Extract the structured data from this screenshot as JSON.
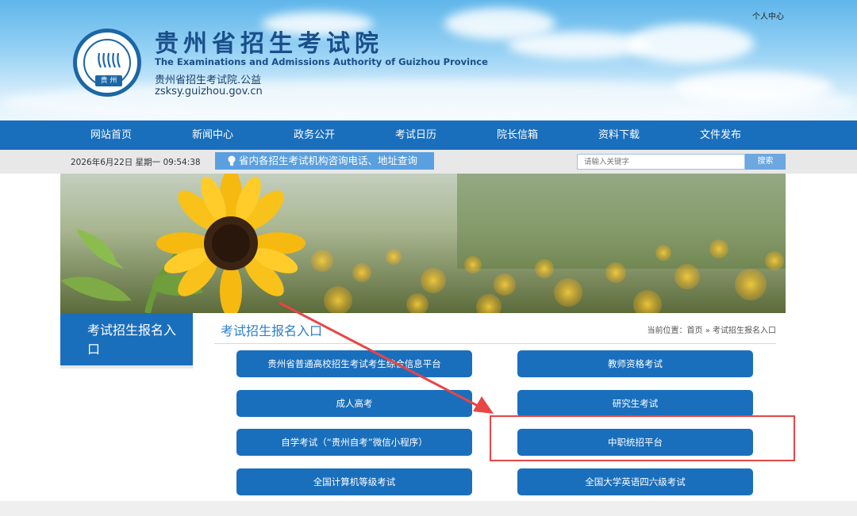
{
  "header": {
    "user_center": "个人中心",
    "title_cn": "贵州省招生考试院",
    "title_en": "The Examinations and Admissions Authority of Guizhou Province",
    "subtitle": "贵州省招生考试院.公益",
    "domain": "zsksy.guizhou.gov.cn",
    "logo_city": "贵 州"
  },
  "nav": {
    "items": [
      "网站首页",
      "新闻中心",
      "政务公开",
      "考试日历",
      "院长信箱",
      "资料下载",
      "文件发布"
    ]
  },
  "infobar": {
    "datetime": "2026年6月22日 星期一 09:54:38",
    "notice": "省内各招生考试机构咨询电话、地址查询",
    "search_placeholder": "请输入关键字",
    "search_button": "搜索"
  },
  "sidebar": {
    "title": "考试招生报名入口"
  },
  "main": {
    "section_title": "考试招生报名入口",
    "breadcrumb": "当前位置：首页 » 考试招生报名入口",
    "entries": [
      "贵州省普通高校招生考试考生综合信息平台",
      "教师资格考试",
      "成人高考",
      "研究生考试",
      "自学考试（“贵州自考”微信小程序）",
      "中职统招平台",
      "全国计算机等级考试",
      "全国大学英语四六级考试"
    ]
  },
  "colors": {
    "primary": "#1a6fbd",
    "highlight": "#e84545"
  }
}
